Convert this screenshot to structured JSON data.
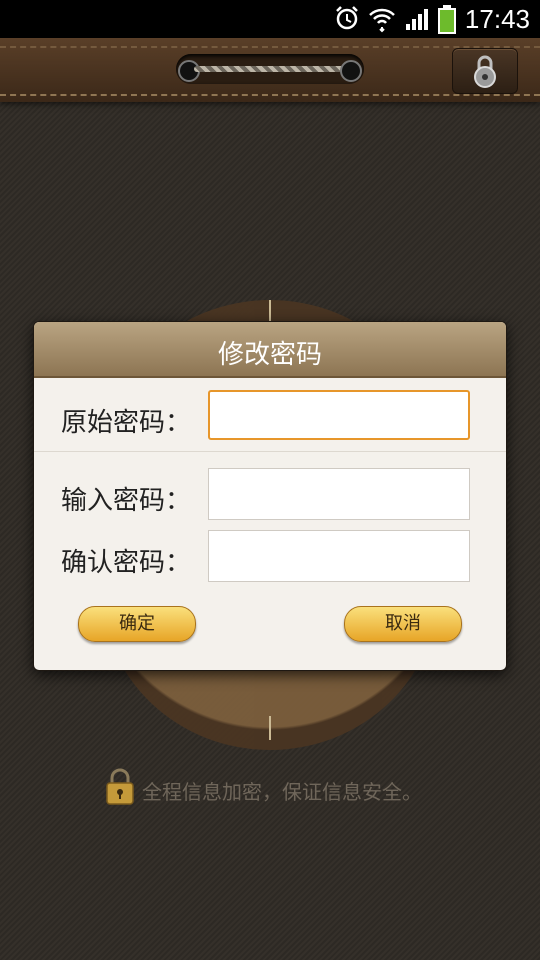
{
  "status_bar": {
    "time": "17:43",
    "icons": [
      "alarm-icon",
      "wifi-icon",
      "signal-icon",
      "battery-icon"
    ]
  },
  "dialog": {
    "title": "修改密码",
    "fields": [
      {
        "label": "原始密码：",
        "value": "",
        "focused": true
      },
      {
        "label": "输入密码：",
        "value": ""
      },
      {
        "label": "确认密码：",
        "value": ""
      }
    ],
    "confirm_label": "确定",
    "cancel_label": "取消"
  },
  "footer": {
    "note": "全程信息加密，保证信息安全。"
  },
  "colors": {
    "focus_border": "#e7962a",
    "button_gold": "#f3c24e",
    "dialog_header": "#a58e6b"
  }
}
